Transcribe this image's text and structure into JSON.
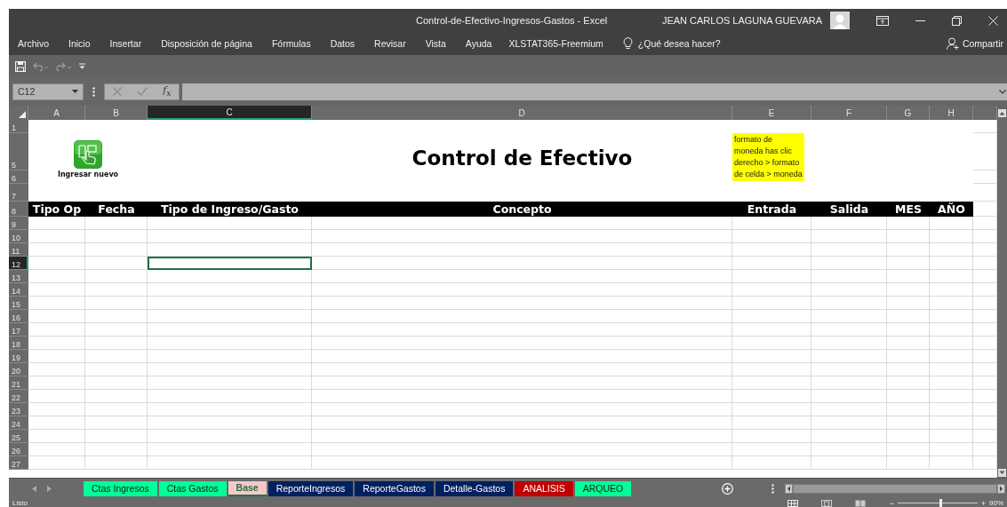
{
  "window": {
    "title": "Control-de-Efectivo-Ingresos-Gastos  -  Excel",
    "user": "JEAN CARLOS LAGUNA GUEVARA"
  },
  "menu": {
    "items": [
      "Archivo",
      "Inicio",
      "Insertar",
      "Disposición de página",
      "Fórmulas",
      "Datos",
      "Revisar",
      "Vista",
      "Ayuda",
      "XLSTAT365-Freemium"
    ],
    "tell_me": "¿Qué desea hacer?",
    "share": "Compartir"
  },
  "formula_bar": {
    "name_box": "C12",
    "function_label": "f$_{x}$"
  },
  "columns": [
    {
      "label": "A",
      "selected": false
    },
    {
      "label": "B",
      "selected": false
    },
    {
      "label": "C",
      "selected": true
    },
    {
      "label": "D",
      "selected": false
    },
    {
      "label": "E",
      "selected": false
    },
    {
      "label": "F",
      "selected": false
    },
    {
      "label": "G",
      "selected": false
    },
    {
      "label": "H",
      "selected": false
    }
  ],
  "rows": [
    {
      "label": "1",
      "kind": "banner",
      "selected": false
    },
    {
      "label": "5",
      "kind": "banner",
      "selected": false
    },
    {
      "label": "6",
      "kind": "banner",
      "selected": false
    },
    {
      "label": "7",
      "kind": "banner",
      "selected": false
    },
    {
      "label": "8",
      "kind": "header",
      "selected": false
    },
    {
      "label": "9",
      "kind": "data",
      "selected": false
    },
    {
      "label": "10",
      "kind": "data",
      "selected": false
    },
    {
      "label": "11",
      "kind": "data",
      "selected": false
    },
    {
      "label": "12",
      "kind": "data",
      "selected": true
    },
    {
      "label": "13",
      "kind": "data",
      "selected": false
    },
    {
      "label": "14",
      "kind": "data",
      "selected": false
    },
    {
      "label": "15",
      "kind": "data",
      "selected": false
    },
    {
      "label": "16",
      "kind": "data",
      "selected": false
    },
    {
      "label": "17",
      "kind": "data",
      "selected": false
    },
    {
      "label": "18",
      "kind": "data",
      "selected": false
    },
    {
      "label": "19",
      "kind": "data",
      "selected": false
    },
    {
      "label": "20",
      "kind": "data",
      "selected": false
    },
    {
      "label": "21",
      "kind": "data",
      "selected": false
    },
    {
      "label": "22",
      "kind": "data",
      "selected": false
    },
    {
      "label": "23",
      "kind": "data",
      "selected": false
    },
    {
      "label": "24",
      "kind": "data",
      "selected": false
    },
    {
      "label": "25",
      "kind": "data",
      "selected": false
    },
    {
      "label": "26",
      "kind": "data",
      "selected": false
    },
    {
      "label": "27",
      "kind": "data",
      "selected": false
    }
  ],
  "sheet": {
    "title": "Control de Efectivo",
    "button_label": "Ingresar nuevo",
    "note": "formato de moneda has clic derecho > formato de celda > moneda",
    "headers": [
      "Tipo Op",
      "Fecha",
      "Tipo de Ingreso/Gasto",
      "Concepto",
      "Entrada",
      "Salida",
      "MES",
      "AÑO"
    ]
  },
  "sheet_tabs": [
    {
      "label": "Ctas Ingresos",
      "color": "#00ff99",
      "selected": false
    },
    {
      "label": "Ctas Gastos",
      "color": "#00ff99",
      "selected": false
    },
    {
      "label": "Base",
      "color": "#f4c7c8",
      "selected": true
    },
    {
      "label": "ReporteIngresos",
      "color": "#002060",
      "selected": false
    },
    {
      "label": "ReporteGastos",
      "color": "#002060",
      "selected": false
    },
    {
      "label": "Detalle-Gastos",
      "color": "#002060",
      "selected": false
    },
    {
      "label": "ANALISIS",
      "color": "#c00000",
      "selected": false
    },
    {
      "label": "ARQUEO",
      "color": "#00ff99",
      "selected": false
    }
  ],
  "status_bar": {
    "status": "Listo",
    "zoom_out": "−",
    "zoom_in": "+",
    "zoom": "90%",
    "zoom_slider": {
      "level": 0.52
    }
  }
}
